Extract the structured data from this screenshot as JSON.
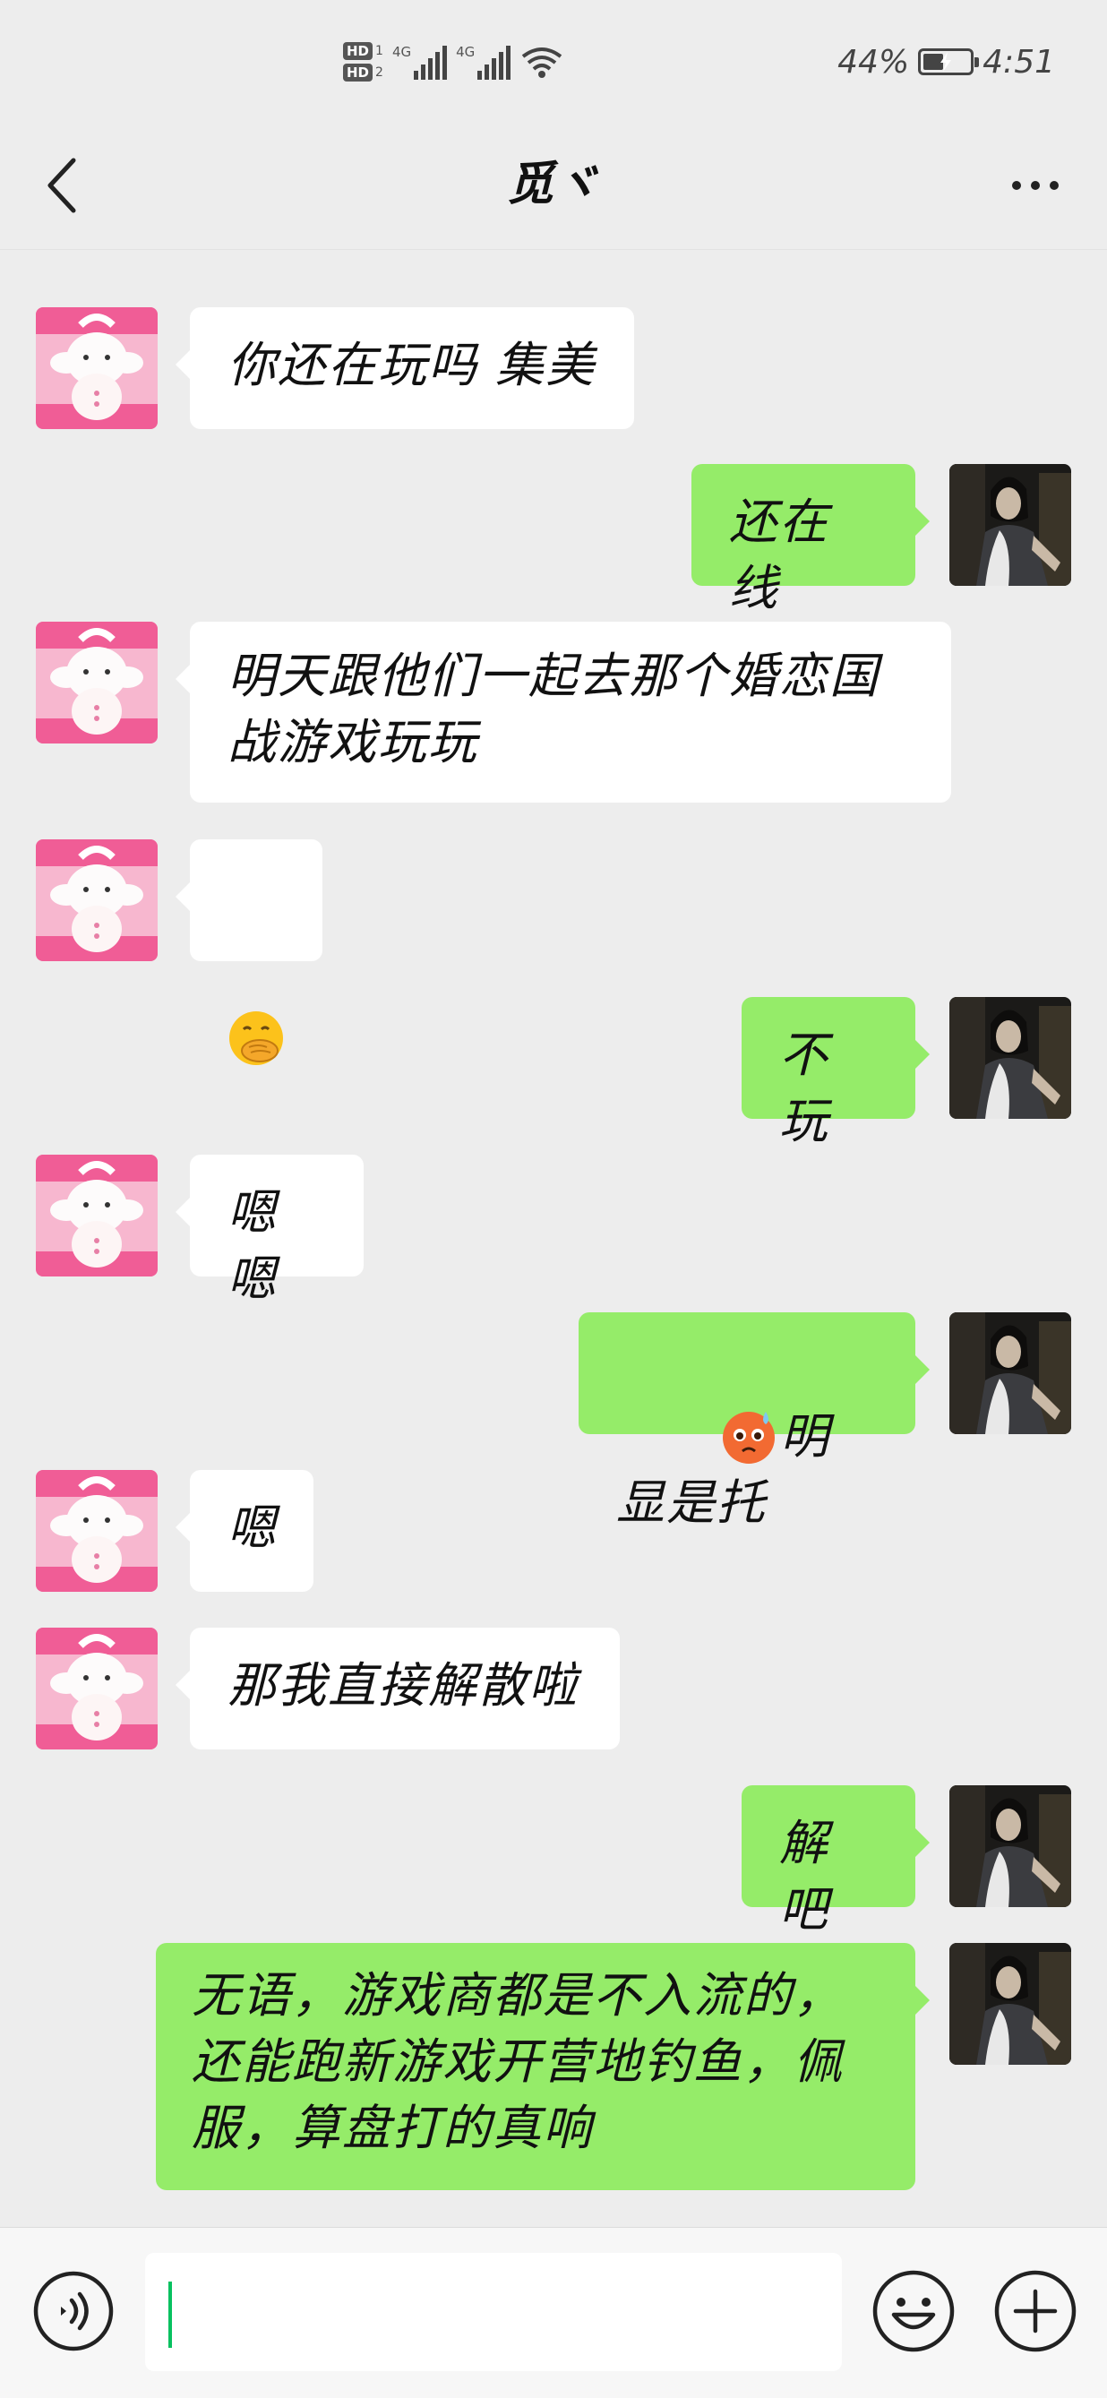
{
  "status_bar": {
    "hd_badges": [
      "HD",
      "HD"
    ],
    "hd_sims": [
      "1",
      "2"
    ],
    "signal_labels": [
      "4G",
      "4G"
    ],
    "battery_percent": "44%",
    "battery_level": 0.44,
    "time": "4:51",
    "icons": [
      "hd-icon",
      "signal-icon",
      "wifi-icon",
      "battery-charging-icon"
    ]
  },
  "header": {
    "title": "觅ヾ",
    "back_icon": "chevron-left-icon",
    "more_icon": "ellipsis-icon"
  },
  "messages": [
    {
      "side": "left",
      "text": "你还在玩吗 集美"
    },
    {
      "side": "right",
      "text": "还在线"
    },
    {
      "side": "left",
      "text": "明天跟他们一起去那个婚恋国\n战游戏玩玩"
    },
    {
      "side": "left",
      "text": "",
      "emoji": "face-with-hand-over-mouth-emoji"
    },
    {
      "side": "right",
      "text": "不玩"
    },
    {
      "side": "left",
      "text": "嗯嗯"
    },
    {
      "side": "right",
      "text": "明显是托",
      "emoji": "anxious-face-with-sweat-emoji"
    },
    {
      "side": "left",
      "text": "嗯"
    },
    {
      "side": "left",
      "text": "那我直接解散啦"
    },
    {
      "side": "right",
      "text": "解吧"
    },
    {
      "side": "right",
      "text": "无语，游戏商都是不入流的，\n还能跑新游戏开营地钓鱼，佩\n服，算盘打的真响"
    }
  ],
  "input_bar": {
    "value": "",
    "voice_icon": "voice-icon",
    "emoji_icon": "smiley-icon",
    "plus_icon": "plus-icon"
  },
  "colors": {
    "background": "#ededed",
    "bubble_self": "#95ec69",
    "bubble_other": "#ffffff",
    "cursor": "#07c160"
  }
}
